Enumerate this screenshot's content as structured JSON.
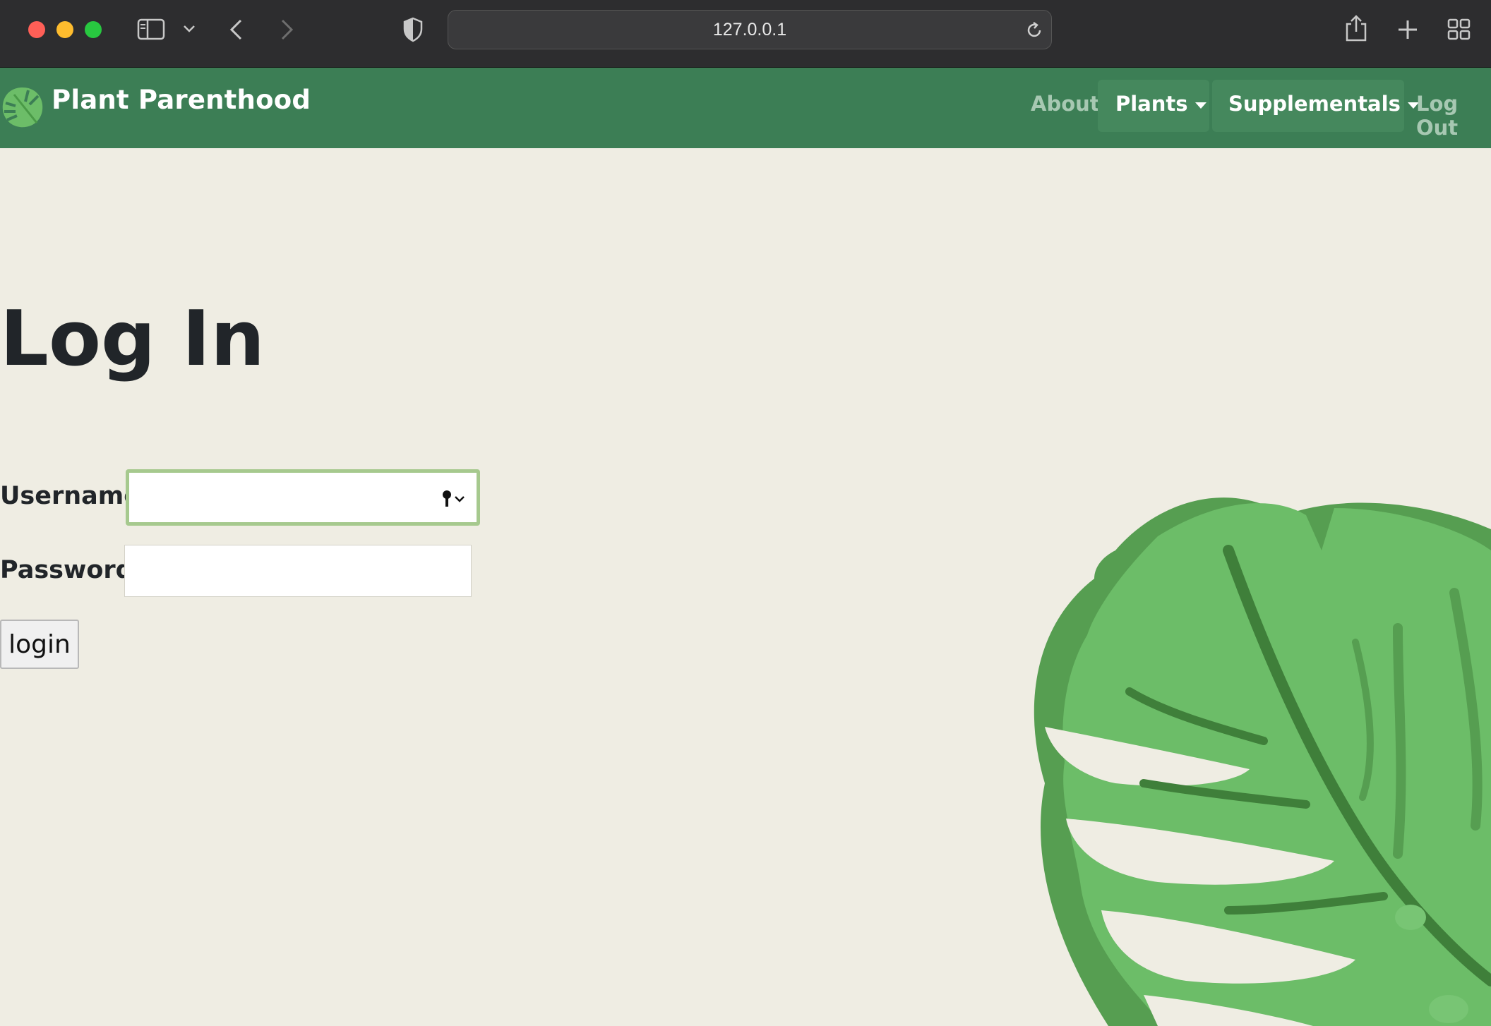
{
  "browser": {
    "url": "127.0.0.1"
  },
  "navbar": {
    "brand": "Plant Parenthood",
    "links": {
      "about": "About",
      "plants": "Plants",
      "supplementals": "Supplementals",
      "logout": "Log Out"
    },
    "colors": {
      "background": "#3c7e55",
      "active_pill": "#45885d",
      "muted_link": "#a7c8b2"
    }
  },
  "page": {
    "title": "Log In",
    "background": "#efede3"
  },
  "form": {
    "username_label": "Username:",
    "username_value": "",
    "password_label": "Password:",
    "password_value": "",
    "submit_label": "login",
    "focus_color": "#a6c98e"
  },
  "decoration": {
    "leaf_color": "#6cbd68",
    "leaf_shadow": "#569e51",
    "leaf_vein": "#3f7f3a"
  }
}
